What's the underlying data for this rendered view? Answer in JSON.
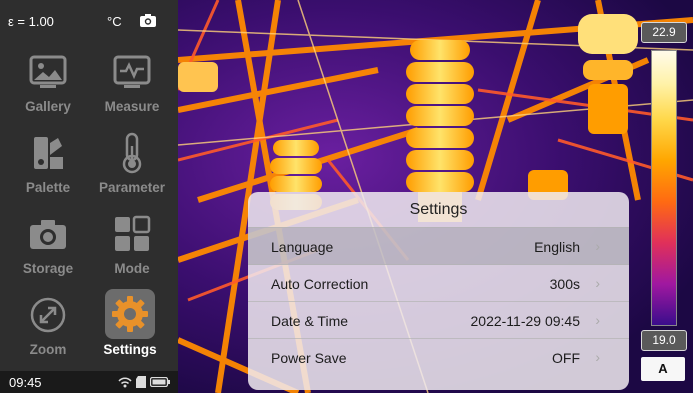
{
  "status": {
    "emissivity": "ε = 1.00",
    "unit": "°C",
    "time": "09:45"
  },
  "menu": [
    {
      "label": "Gallery",
      "icon": "image-icon"
    },
    {
      "label": "Measure",
      "icon": "measure-icon"
    },
    {
      "label": "Palette",
      "icon": "palette-icon"
    },
    {
      "label": "Parameter",
      "icon": "thermometer-icon"
    },
    {
      "label": "Storage",
      "icon": "camera-icon"
    },
    {
      "label": "Mode",
      "icon": "grid-icon"
    },
    {
      "label": "Zoom",
      "icon": "zoom-icon"
    },
    {
      "label": "Settings",
      "icon": "gear-icon",
      "active": true
    }
  ],
  "scale": {
    "max": "22.9",
    "min": "19.0",
    "mode": "A"
  },
  "settings": {
    "title": "Settings",
    "rows": [
      {
        "label": "Language",
        "value": "English"
      },
      {
        "label": "Auto Correction",
        "value": "300s"
      },
      {
        "label": "Date & Time",
        "value": "2022-11-29 09:45"
      },
      {
        "label": "Power Save",
        "value": "OFF"
      }
    ]
  },
  "colors": {
    "accent": "#e8912a",
    "sidebar": "#2e2e2e",
    "tile_active": "#6c6c6c"
  }
}
